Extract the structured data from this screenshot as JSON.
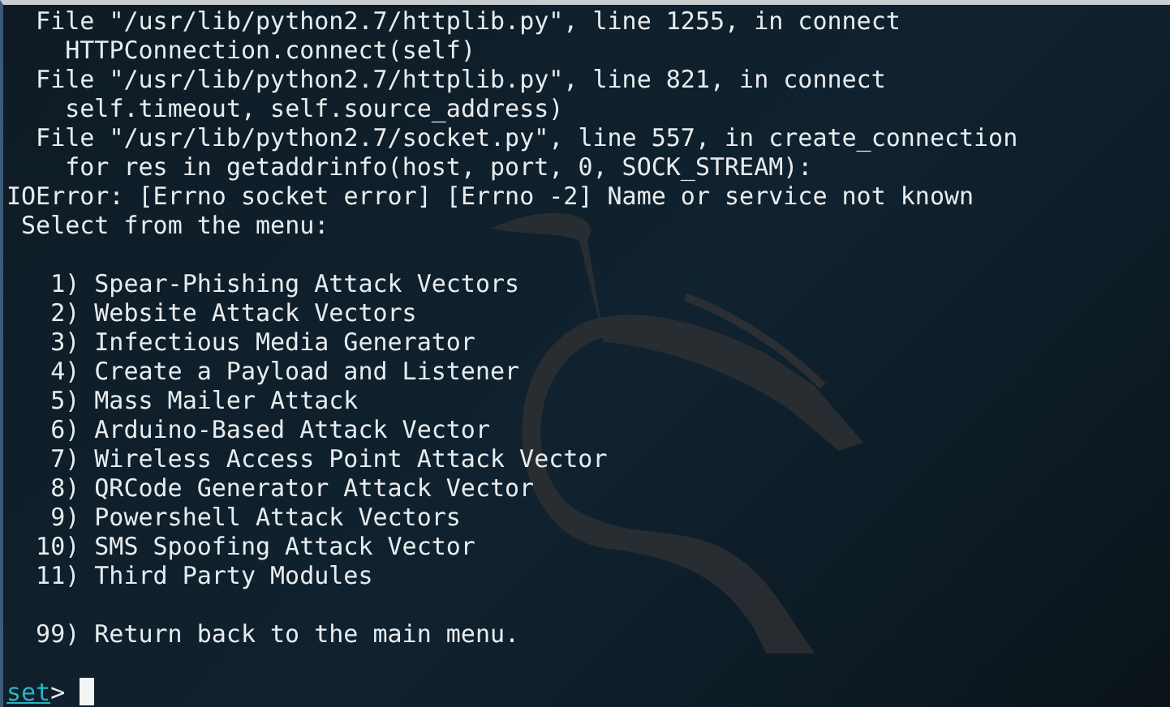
{
  "traceback": [
    "  File \"/usr/lib/python2.7/httplib.py\", line 1255, in connect",
    "    HTTPConnection.connect(self)",
    "  File \"/usr/lib/python2.7/httplib.py\", line 821, in connect",
    "    self.timeout, self.source_address)",
    "  File \"/usr/lib/python2.7/socket.py\", line 557, in create_connection",
    "    for res in getaddrinfo(host, port, 0, SOCK_STREAM):",
    "IOError: [Errno socket error] [Errno -2] Name or service not known",
    " Select from the menu:"
  ],
  "menu": [
    {
      "number": "1)",
      "label": "Spear-Phishing Attack Vectors"
    },
    {
      "number": "2)",
      "label": "Website Attack Vectors"
    },
    {
      "number": "3)",
      "label": "Infectious Media Generator"
    },
    {
      "number": "4)",
      "label": "Create a Payload and Listener"
    },
    {
      "number": "5)",
      "label": "Mass Mailer Attack"
    },
    {
      "number": "6)",
      "label": "Arduino-Based Attack Vector"
    },
    {
      "number": "7)",
      "label": "Wireless Access Point Attack Vector"
    },
    {
      "number": "8)",
      "label": "QRCode Generator Attack Vector"
    },
    {
      "number": "9)",
      "label": "Powershell Attack Vectors"
    },
    {
      "number": "10)",
      "label": "SMS Spoofing Attack Vector"
    },
    {
      "number": "11)",
      "label": "Third Party Modules"
    }
  ],
  "exit_option": {
    "number": "99)",
    "label": "Return back to the main menu."
  },
  "prompt": {
    "name": "set",
    "symbol": ">"
  }
}
